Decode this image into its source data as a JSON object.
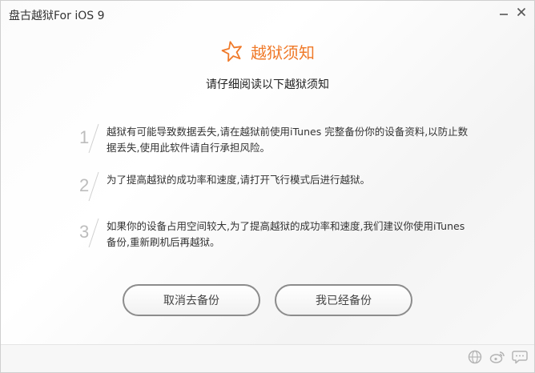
{
  "window": {
    "title": "盘古越狱For iOS 9"
  },
  "header": {
    "title": "越狱须知",
    "subtitle": "请仔细阅读以下越狱须知"
  },
  "notes": [
    {
      "number": "1",
      "text": "越狱有可能导致数据丢失,请在越狱前使用iTunes 完整备份你的设备资料,以防止数据丢失,使用此软件请自行承担风险。"
    },
    {
      "number": "2",
      "text": "为了提高越狱的成功率和速度,请打开飞行模式后进行越狱。"
    },
    {
      "number": "3",
      "text": "如果你的设备占用空间较大,为了提高越狱的成功率和速度,我们建议你使用iTunes备份,重新刷机后再越狱。"
    }
  ],
  "buttons": {
    "cancel": "取消去备份",
    "confirm": "我已经备份"
  },
  "colors": {
    "accent": "#f07a2a",
    "text": "#333333",
    "button_border": "#8c8c8c",
    "icon_gray": "#b5b5b5"
  },
  "icons": {
    "minimize": "minimize-icon",
    "close": "close-icon",
    "header": "star-icon",
    "footer": [
      "globe-icon",
      "weibo-icon",
      "chat-icon"
    ]
  }
}
